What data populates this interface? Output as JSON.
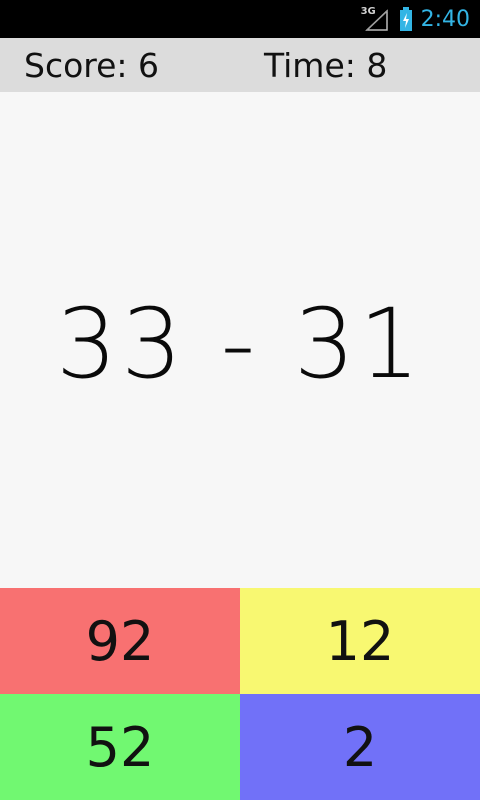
{
  "status_bar": {
    "network_label": "3G",
    "time": "2:40",
    "icons": [
      "signal-icon",
      "battery-charging-icon"
    ]
  },
  "header": {
    "score_text": "Score: 6",
    "time_text": "Time: 8"
  },
  "question": {
    "text": "33 - 31"
  },
  "answers": [
    {
      "label": "92",
      "color": "#f87171"
    },
    {
      "label": "12",
      "color": "#f8f871"
    },
    {
      "label": "52",
      "color": "#71f871"
    },
    {
      "label": "2",
      "color": "#7171f8"
    }
  ],
  "colors": {
    "status_bar_bg": "#000000",
    "header_bg": "#dcdcdc",
    "clock": "#33b5e5"
  }
}
